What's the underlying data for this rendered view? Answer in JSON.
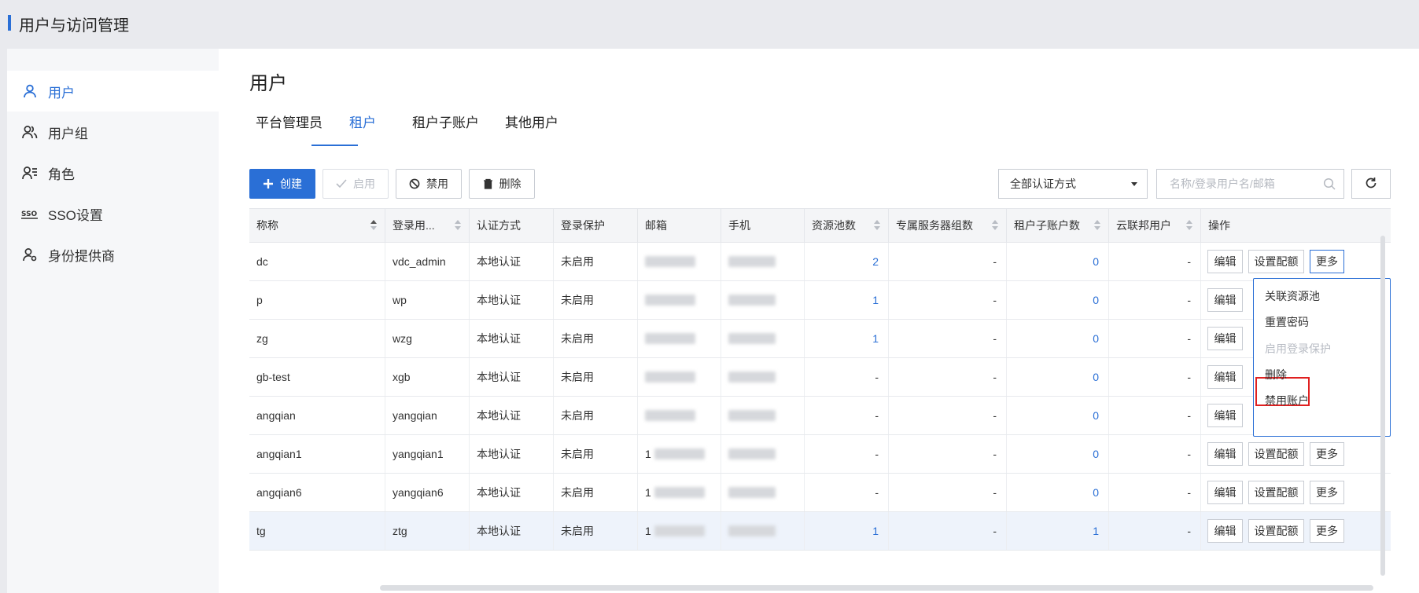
{
  "header": {
    "title": "用户与访问管理"
  },
  "sidebar": {
    "items": [
      {
        "label": "用户",
        "icon": "user-icon",
        "active": true
      },
      {
        "label": "用户组",
        "icon": "user-group-icon"
      },
      {
        "label": "角色",
        "icon": "role-icon"
      },
      {
        "label": "SSO设置",
        "icon": "sso-icon"
      },
      {
        "label": "身份提供商",
        "icon": "identity-provider-icon"
      }
    ]
  },
  "page": {
    "title": "用户"
  },
  "tabs": [
    {
      "label": "平台管理员"
    },
    {
      "label": "租户",
      "active": true
    },
    {
      "label": "租户子账户"
    },
    {
      "label": "其他用户"
    }
  ],
  "toolbar": {
    "create": "创建",
    "enable": "启用",
    "disable": "禁用",
    "delete": "删除",
    "auth_filter": "全部认证方式",
    "search_placeholder": "名称/登录用户名/邮箱"
  },
  "table": {
    "columns": [
      "称称",
      "登录用...",
      "认证方式",
      "登录保护",
      "邮箱",
      "手机",
      "资源池数",
      "专属服务器组数",
      "租户子账户数",
      "云联邦用户",
      "操作"
    ],
    "rows": [
      {
        "name": "dc",
        "login": "vdc_admin",
        "auth": "本地认证",
        "protect": "未启用",
        "pools": "2",
        "servers": "-",
        "subs": "0",
        "fed": "-",
        "more": true
      },
      {
        "name": "p",
        "login": "wp",
        "auth": "本地认证",
        "protect": "未启用",
        "pools": "1",
        "servers": "-",
        "subs": "0",
        "fed": "-"
      },
      {
        "name": "zg",
        "login": "wzg",
        "auth": "本地认证",
        "protect": "未启用",
        "pools": "1",
        "servers": "-",
        "subs": "0",
        "fed": "-"
      },
      {
        "name": "gb-test",
        "login": "xgb",
        "auth": "本地认证",
        "protect": "未启用",
        "pools": "-",
        "servers": "-",
        "subs": "0",
        "fed": "-"
      },
      {
        "name": "angqian",
        "login": "yangqian",
        "auth": "本地认证",
        "protect": "未启用",
        "pools": "-",
        "servers": "-",
        "subs": "0",
        "fed": "-"
      },
      {
        "name": "angqian1",
        "login": "yangqian1",
        "auth": "本地认证",
        "protect": "未启用",
        "pools": "-",
        "servers": "-",
        "subs": "0",
        "fed": "-",
        "email_prefix": "1"
      },
      {
        "name": "angqian6",
        "login": "yangqian6",
        "auth": "本地认证",
        "protect": "未启用",
        "pools": "-",
        "servers": "-",
        "subs": "0",
        "fed": "-",
        "email_prefix": "1"
      },
      {
        "name": "tg",
        "login": "ztg",
        "auth": "本地认证",
        "protect": "未启用",
        "pools": "1",
        "servers": "-",
        "subs": "1",
        "fed": "-",
        "email_prefix": "1"
      }
    ],
    "actions": {
      "edit": "编辑",
      "quota": "设置配额",
      "more": "更多"
    }
  },
  "more_menu": {
    "items": [
      {
        "label": "关联资源池"
      },
      {
        "label": "重置密码"
      },
      {
        "label": "启用登录保护",
        "disabled": true
      },
      {
        "label": "删除",
        "highlighted": true
      },
      {
        "label": "禁用账户"
      }
    ]
  },
  "colors": {
    "accent": "#2a6fd6",
    "highlight_border": "#e02020"
  }
}
